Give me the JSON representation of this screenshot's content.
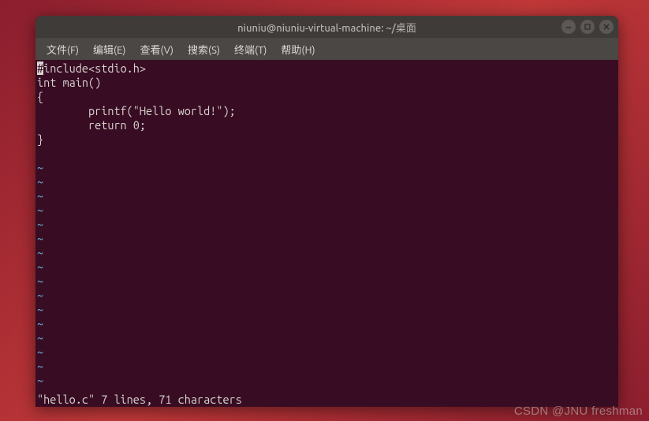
{
  "window": {
    "title": "niuniu@niuniu-virtual-machine: ~/桌面"
  },
  "menubar": {
    "file": "文件(F)",
    "edit": "编辑(E)",
    "view": "查看(V)",
    "search": "搜索(S)",
    "terminal": "终端(T)",
    "help": "帮助(H)"
  },
  "editor": {
    "cursor_char": "#",
    "lines": [
      "include<stdio.h>",
      "int main()",
      "{",
      "        printf(\"Hello world!\");",
      "        return 0;",
      "}",
      " "
    ],
    "tilde": "~",
    "status": "\"hello.c\" 7 lines, 71 characters"
  },
  "watermark": "CSDN @JNU freshman"
}
